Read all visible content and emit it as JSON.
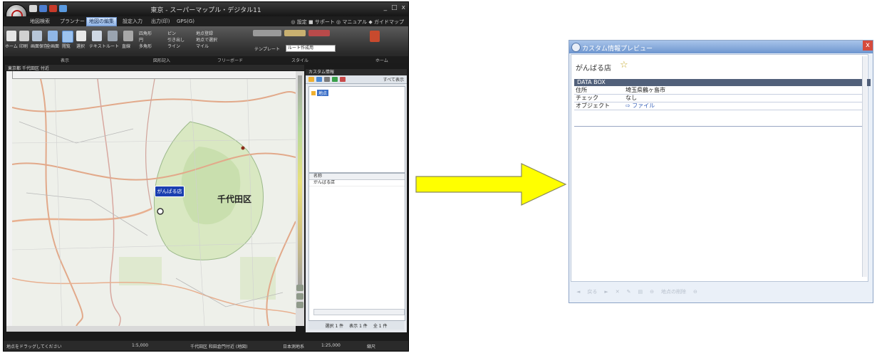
{
  "app": {
    "title": "東京 - スーパーマップル・デジタル11",
    "controls": [
      "_",
      "□",
      "x"
    ]
  },
  "menu_tabs": [
    "地図検索",
    "プランナー",
    "地図の編集",
    "設定入力",
    "出力(印)",
    "GPS(G)"
  ],
  "active_tab_index": 2,
  "help_links": "◎ 設定  ■ サポート  ◎ マニュアル  ◆ ガイドマップ",
  "ribbon": {
    "buttons": [
      "ホーム",
      "印刷",
      "画面保存",
      "全画面",
      "閲覧",
      "選択",
      "テキスト",
      "ルート",
      "直線"
    ],
    "selected_index": 4,
    "small_items": [
      "四角形",
      "円",
      "多角形",
      "ピン",
      "引き出し",
      "ライン",
      "地点登録",
      "地点で選択",
      "マイル",
      "テンプレート"
    ],
    "template_value": "ルート作成用",
    "groups": [
      "表示",
      "図形記入",
      "フリーボード",
      "スタイル",
      "ホーム"
    ]
  },
  "doc_tab": "東京都 千代田区 付近",
  "map": {
    "district_label": "千代田区",
    "poi_callout": "がんばる店"
  },
  "side_panel": {
    "title": "カスタム情報",
    "show_all_label": "すべて表示",
    "tree_item": "地点",
    "list_header": "名称",
    "list_row": "がんばる店",
    "footer": [
      "選択 1 件",
      "表示 1 件",
      "全 1 件"
    ]
  },
  "statusbar": [
    "地点をドラッグしてください",
    "1:5,000",
    "千代田区 和田倉門付近 (地図)",
    "日本測地系",
    "1:25,000",
    "縮尺"
  ],
  "preview": {
    "title": "カスタム情報プレビュー",
    "close": "x",
    "heading": "がんばる店",
    "star": "☆",
    "databox_label": "DATA BOX",
    "rows": [
      {
        "label": "住所",
        "value": "埼玉県鶴ヶ島市",
        "link": false
      },
      {
        "label": "チェック",
        "value": "なし",
        "link": false
      },
      {
        "label": "オブジェクト",
        "value": "ファイル",
        "link": true
      }
    ],
    "toolbar": [
      "戻る",
      "地点の削除"
    ]
  },
  "colors": {
    "arrow_fill": "#ffff00",
    "arrow_stroke": "#8a8a5a",
    "map_background": "#eef0ea",
    "callout_fill": "#1a3fb0",
    "preview_title": "#7fa3d8"
  }
}
